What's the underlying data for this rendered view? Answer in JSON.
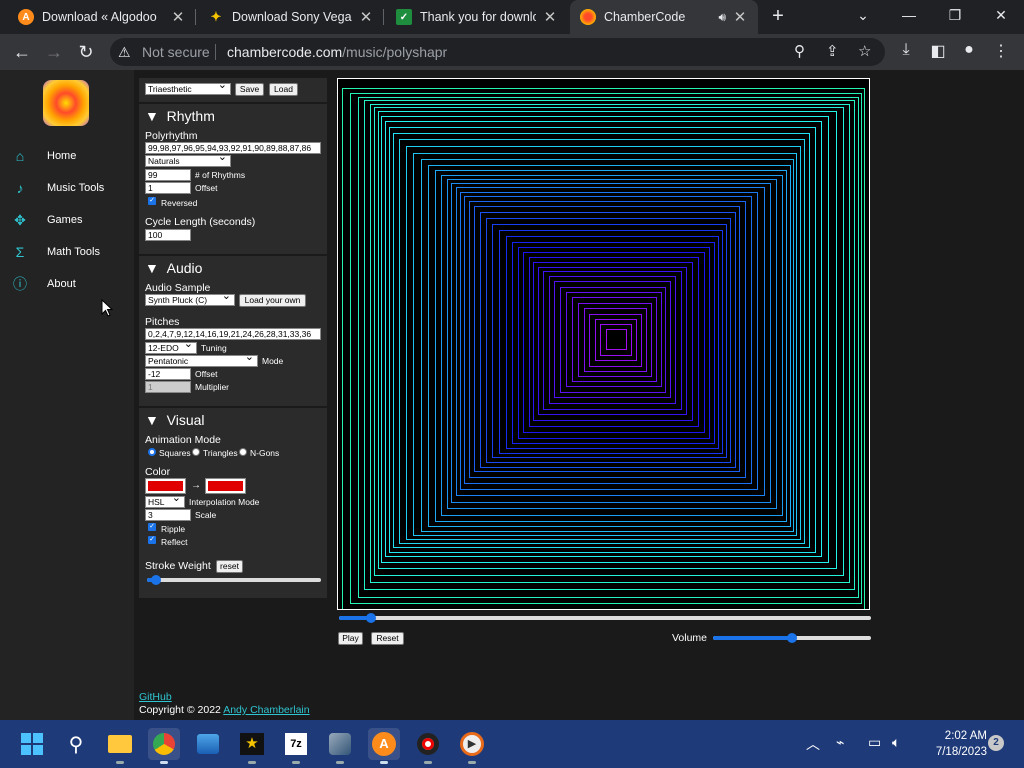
{
  "browser": {
    "tabs": [
      {
        "title": "Download « Algodoo",
        "icon": "algodoo-icon",
        "color": "#ff8c1a"
      },
      {
        "title": "Download Sony Vegas",
        "icon": "vegas-icon",
        "color": "#f5c400"
      },
      {
        "title": "Thank you for downloa",
        "icon": "sheet-icon",
        "color": "#1e8e3e"
      },
      {
        "title": "ChamberCode",
        "icon": "chambercode-icon",
        "color": "#ffb300",
        "active": true
      }
    ],
    "security": "Not secure",
    "url_host": "chambercode.com",
    "url_path": "/music/polyshapr"
  },
  "nav": {
    "items": [
      {
        "label": "Home",
        "icon": "home-icon"
      },
      {
        "label": "Music Tools",
        "icon": "music-note-icon"
      },
      {
        "label": "Games",
        "icon": "gamepad-icon"
      },
      {
        "label": "Math Tools",
        "icon": "sigma-icon"
      },
      {
        "label": "About",
        "icon": "info-icon"
      }
    ]
  },
  "preset": {
    "value": "Triaesthetic",
    "save": "Save",
    "load": "Load"
  },
  "rhythm": {
    "title": "Rhythm",
    "polyrhythm_label": "Polyrhythm",
    "polyrhythm_value": "99,98,97,96,95,94,93,92,91,90,89,88,87,86",
    "sequence": "Naturals",
    "count_value": "99",
    "count_label": "# of Rhythms",
    "offset_value": "1",
    "offset_label": "Offset",
    "reversed_label": "Reversed",
    "cycle_label": "Cycle Length (seconds)",
    "cycle_value": "100"
  },
  "audio": {
    "title": "Audio",
    "sample_label": "Audio Sample",
    "sample_value": "Synth Pluck (C)",
    "load_own": "Load your own",
    "pitches_label": "Pitches",
    "pitches_value": "0,2,4,7,9,12,14,16,19,21,24,26,28,31,33,36",
    "tuning_value": "12-EDO",
    "tuning_label": "Tuning",
    "mode_value": "Pentatonic",
    "mode_label": "Mode",
    "offset_value": "-12",
    "offset_label": "Offset",
    "multiplier_value": "1",
    "multiplier_label": "Multiplier"
  },
  "visual": {
    "title": "Visual",
    "anim_label": "Animation Mode",
    "mode_squares": "Squares",
    "mode_triangles": "Triangles",
    "mode_ngons": "N-Gons",
    "color_label": "Color",
    "color_a": "#e00000",
    "color_b": "#e00000",
    "interp_value": "HSL",
    "interp_label": "Interpolation Mode",
    "scale_value": "3",
    "scale_label": "Scale",
    "ripple_label": "Ripple",
    "reflect_label": "Reflect",
    "stroke_label": "Stroke Weight",
    "stroke_reset": "reset",
    "stroke_level": 0.05
  },
  "player": {
    "progress": 0.06,
    "play": "Play",
    "reset": "Reset",
    "volume_label": "Volume",
    "volume": 0.5
  },
  "footer": {
    "github": "GitHub",
    "copyright": "Copyright © 2022",
    "author": "Andy Chamberlain"
  },
  "taskbar": {
    "time": "2:02 AM",
    "date": "7/18/2023",
    "notifications": "2"
  }
}
